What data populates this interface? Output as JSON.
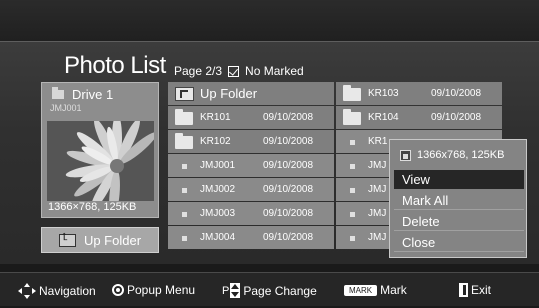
{
  "header": {
    "title": "Photo List"
  },
  "page_info": {
    "page": "Page 2/3",
    "marked": "No Marked"
  },
  "preview": {
    "drive": "Drive 1",
    "file": "JMJ001",
    "resolution": "1366×768, 125KB"
  },
  "up_button": {
    "label": "Up Folder"
  },
  "grid": {
    "up_folder": "Up Folder",
    "left": [
      {
        "name": "KR101",
        "date": "09/10/2008",
        "type": "folder"
      },
      {
        "name": "KR102",
        "date": "09/10/2008",
        "type": "folder"
      },
      {
        "name": "JMJ001",
        "date": "09/10/2008",
        "type": "file"
      },
      {
        "name": "JMJ002",
        "date": "09/10/2008",
        "type": "file"
      },
      {
        "name": "JMJ003",
        "date": "09/10/2008",
        "type": "file"
      },
      {
        "name": "JMJ004",
        "date": "09/10/2008",
        "type": "file"
      }
    ],
    "right": [
      {
        "name": "KR103",
        "date": "09/10/2008",
        "type": "folder"
      },
      {
        "name": "KR104",
        "date": "09/10/2008",
        "type": "folder"
      },
      {
        "name": "KR1",
        "date": "",
        "type": "file"
      },
      {
        "name": "JMJ",
        "date": "",
        "type": "file"
      },
      {
        "name": "JMJ",
        "date": "",
        "type": "file"
      },
      {
        "name": "JMJ",
        "date": "",
        "type": "file"
      },
      {
        "name": "JMJ",
        "date": "",
        "type": "file"
      }
    ]
  },
  "popup": {
    "info": "1366x768, 125KB",
    "items": [
      "View",
      "Mark All",
      "Delete",
      "Close"
    ],
    "selected": "View"
  },
  "footer": {
    "navigation": "Navigation",
    "popup_menu": "Popup Menu",
    "p_label": "P",
    "page_change": "Page Change",
    "mark_badge": "MARK",
    "mark": "Mark",
    "exit": "Exit"
  },
  "colors": {
    "cell_folder_bg": "#7f7f7f",
    "cell_file_bg": "#8a8a8a",
    "popup_selected": "#262626"
  }
}
